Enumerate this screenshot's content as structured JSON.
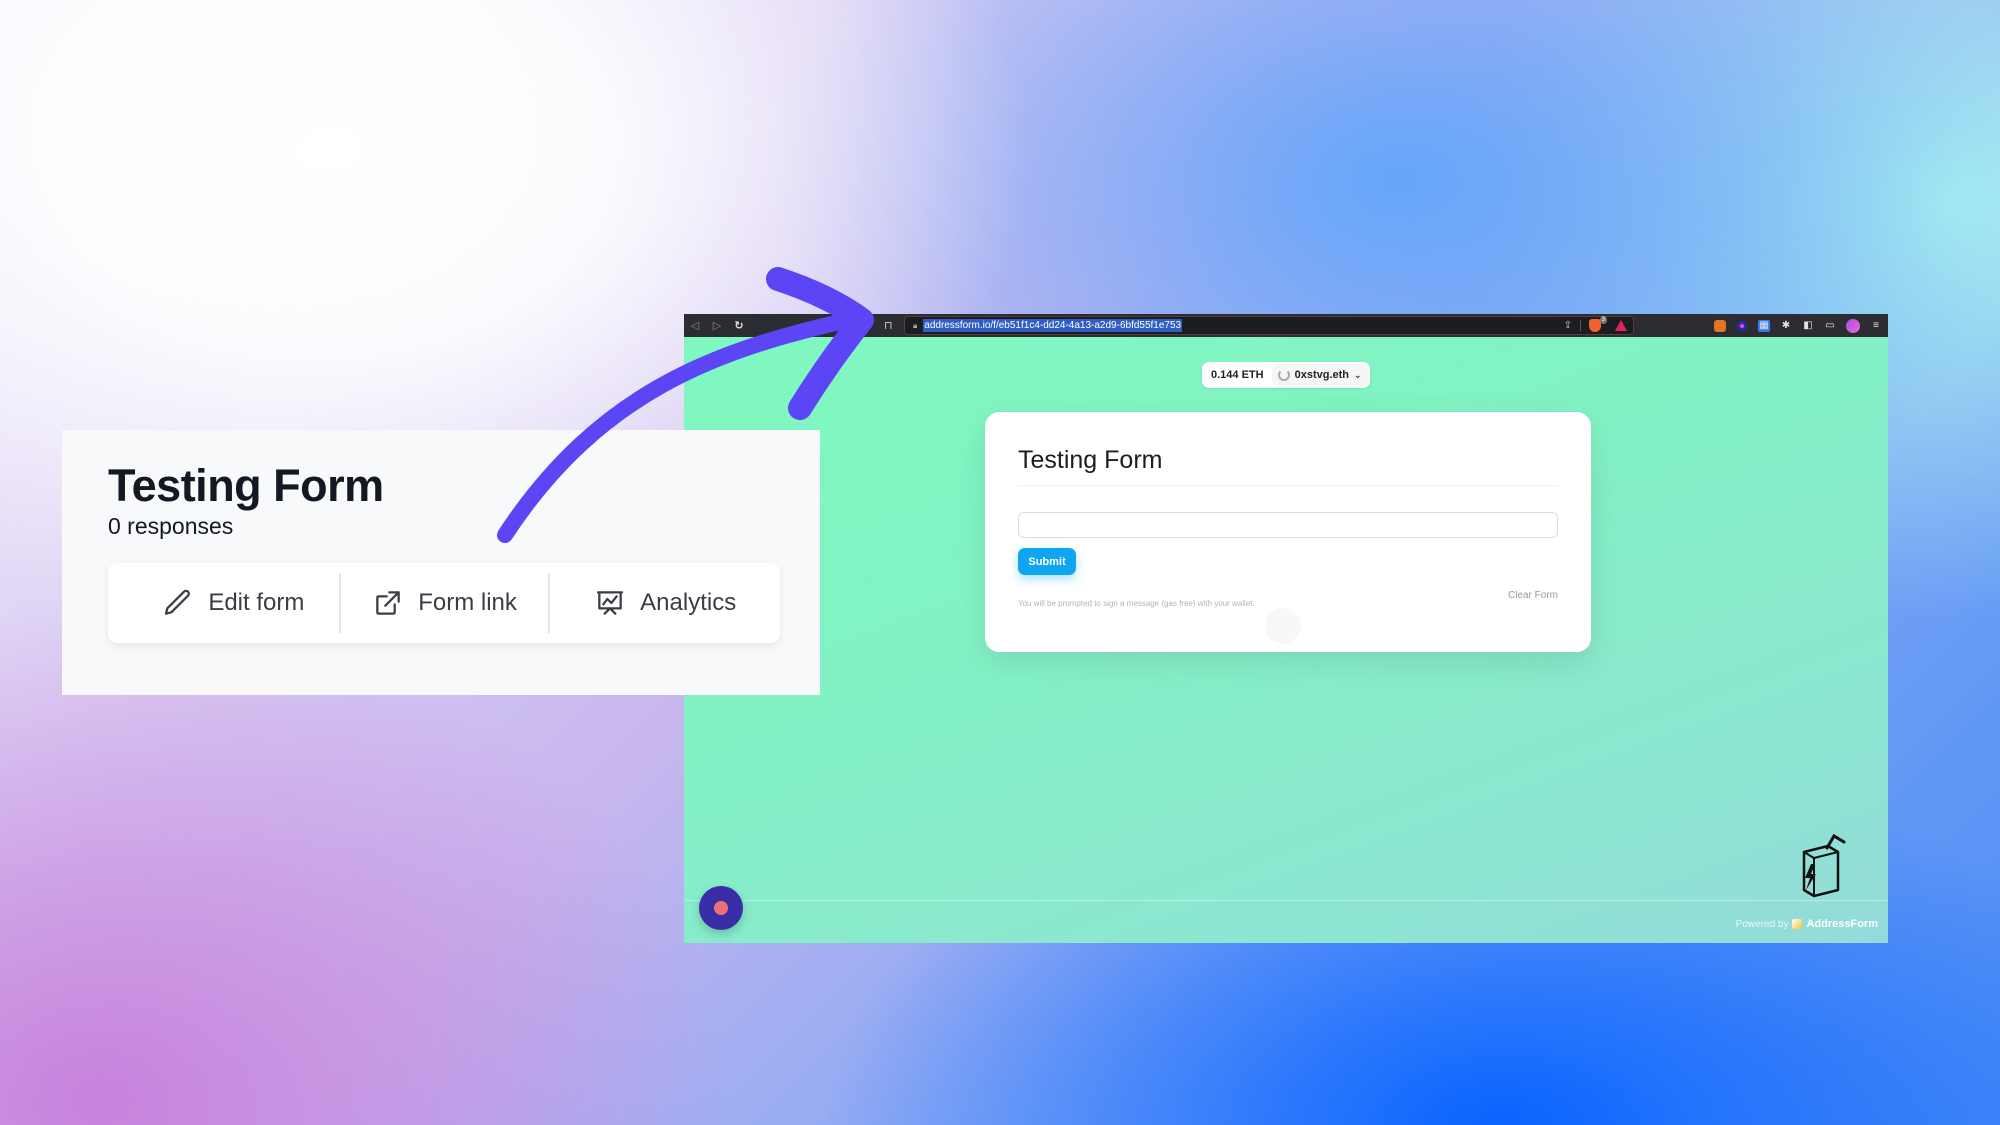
{
  "left_card": {
    "title": "Testing Form",
    "responses": "0 responses",
    "actions": [
      {
        "label": "Edit form",
        "icon": "pencil-icon"
      },
      {
        "label": "Form link",
        "icon": "external-link-icon"
      },
      {
        "label": "Analytics",
        "icon": "presentation-chart-icon"
      }
    ]
  },
  "browser": {
    "nav": {
      "back": "◁",
      "forward": "▷",
      "reload": "↻"
    },
    "url": "addressform.io/f/eb51f1c4-dd24-4a13-a2d9-6bfd55f1e753",
    "brave_shield_count": "3",
    "extensions": [
      "metamask-icon",
      "extension-dot-icon",
      "grid-extension-icon",
      "puzzle-icon",
      "sidebar-icon",
      "wallet-icon",
      "profile-avatar-icon",
      "menu-icon"
    ]
  },
  "wallet": {
    "balance": "0.144 ETH",
    "account": "0xstvg.eth"
  },
  "form": {
    "title": "Testing Form",
    "input_value": "",
    "submit_label": "Submit",
    "note": "You will be prompted to sign a message (gas free) with your wallet.",
    "clear_label": "Clear Form"
  },
  "footer": {
    "powered_by": "Powered by",
    "brand": "AddressForm"
  },
  "colors": {
    "arrow": "#5b45f5",
    "submit": "#0ea5f2",
    "page_bg": "#7ff8c0",
    "fab": "#3a2ea8"
  }
}
